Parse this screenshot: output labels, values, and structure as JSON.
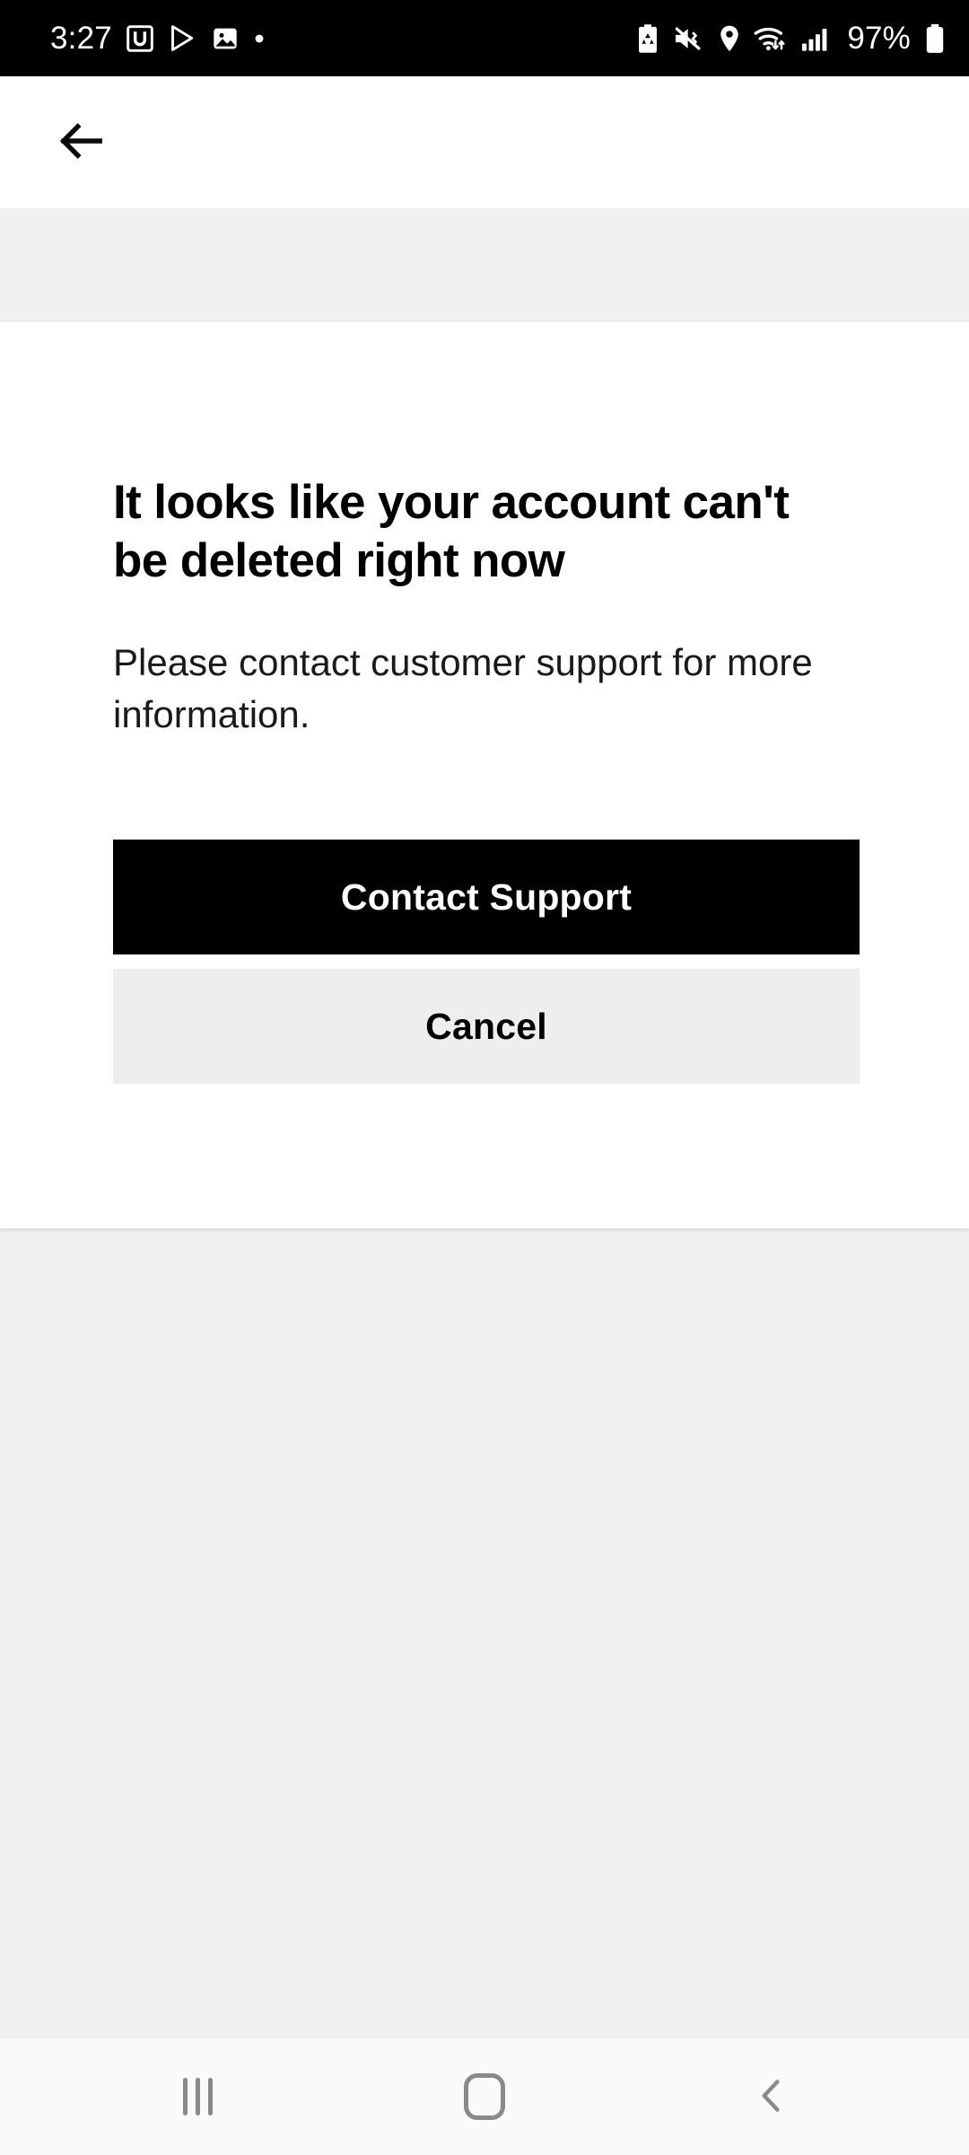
{
  "status_bar": {
    "time": "3:27",
    "battery_percent": "97%",
    "left_icons": [
      {
        "name": "uber-app-icon",
        "glyph": "U"
      },
      {
        "name": "play-store-icon",
        "glyph": "play"
      },
      {
        "name": "gallery-image-icon",
        "glyph": "image"
      },
      {
        "name": "notification-dot-icon",
        "glyph": "dot"
      }
    ],
    "right_icons": [
      {
        "name": "battery-saver-icon",
        "glyph": "recycle-battery"
      },
      {
        "name": "sound-mute-vibrate-icon",
        "glyph": "mute"
      },
      {
        "name": "location-pin-icon",
        "glyph": "pin"
      },
      {
        "name": "wifi-icon",
        "glyph": "wifi-transfer"
      },
      {
        "name": "cellular-signal-icon",
        "glyph": "signal-bars"
      },
      {
        "name": "battery-icon",
        "glyph": "battery-full"
      }
    ]
  },
  "app_bar": {
    "back_icon": "arrow-left-icon"
  },
  "main": {
    "headline": "It looks like your account can't be deleted right now",
    "body": "Please contact customer support for more information.",
    "primary_button": "Contact Support",
    "secondary_button": "Cancel"
  },
  "nav_bar": {
    "recents_label": "recents-icon",
    "home_label": "home-icon",
    "back_label": "back-chevron-icon"
  },
  "colors": {
    "status_bar_bg": "#000000",
    "app_bar_bg": "#ffffff",
    "page_bg": "#f0f0f0",
    "card_bg": "#ffffff",
    "primary_button_bg": "#000000",
    "primary_button_text": "#ffffff",
    "secondary_button_bg": "#eeeeee",
    "secondary_button_text": "#000000",
    "nav_bar_bg": "#fafafa",
    "nav_icon": "#8a8a8a"
  }
}
